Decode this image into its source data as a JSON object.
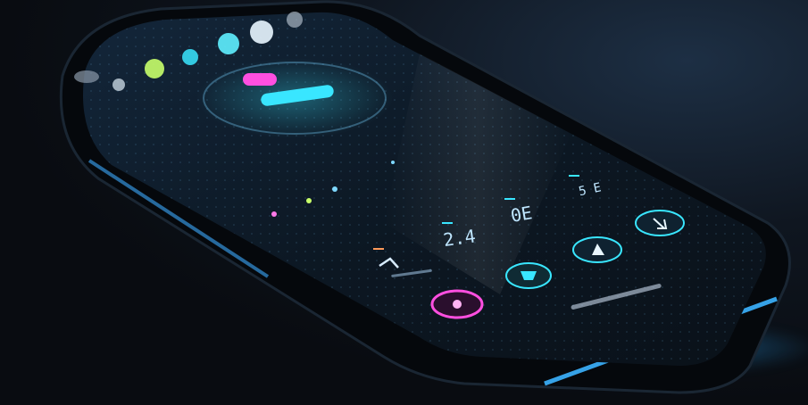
{
  "readouts": {
    "left": "2.4",
    "middle": "0E",
    "right": "5 E"
  },
  "colors": {
    "accent_cyan": "#39e6ff",
    "accent_magenta": "#ff4fe0",
    "accent_green": "#c8ff6a",
    "screen_bg": "#0c1620"
  },
  "icons": [
    "shield-icon",
    "triangle-icon",
    "arrow-icon",
    "power-icon",
    "info-icon"
  ]
}
